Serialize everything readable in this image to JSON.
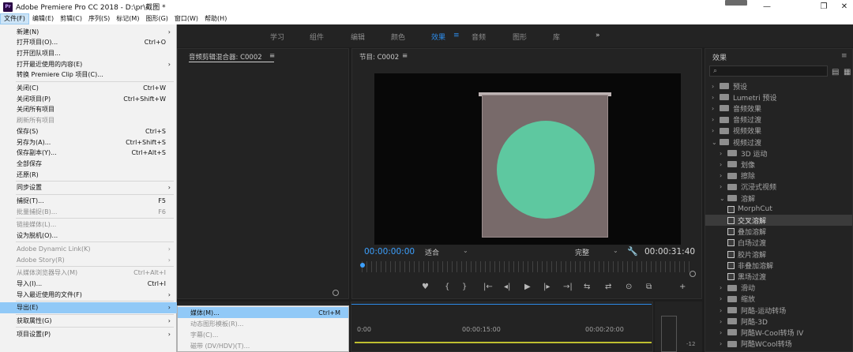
{
  "titlebar": {
    "app_icon": "Pr",
    "title": "Adobe Premiere Pro CC 2018 - D:\\pr\\截图 *",
    "minimize_icon": "minimize-icon",
    "maximize_icon": "maximize-icon",
    "close_icon": "close-icon"
  },
  "menubar": [
    "文件(F)",
    "编辑(E)",
    "剪辑(C)",
    "序列(S)",
    "标记(M)",
    "图形(G)",
    "窗口(W)",
    "帮助(H)"
  ],
  "workspaces": [
    "学习",
    "组件",
    "编辑",
    "颜色",
    "效果",
    "音频",
    "图形",
    "库",
    "»"
  ],
  "active_workspace": "效果",
  "mixer": {
    "title": "音频剪辑混合器: C0002",
    "menu_icon": "≡"
  },
  "program": {
    "title": "节目: C0002",
    "menu_icon": "≡",
    "timecode_current": "00:00:00:00",
    "fit": "适合",
    "quality": "完整",
    "timecode_total": "00:00:31:40",
    "controls": [
      "♥",
      "{",
      "}",
      "|←",
      "◂|",
      "▶",
      "|▸",
      "→|",
      "⇆",
      "⇄",
      "⊙",
      "⧉",
      "+"
    ]
  },
  "effects": {
    "title": "效果",
    "menu_icon": "≡",
    "search_placeholder": "⌕",
    "items": [
      {
        "label": "预设",
        "level": 0,
        "type": "folder",
        "arrow": "›"
      },
      {
        "label": "Lumetri 预设",
        "level": 0,
        "type": "folder",
        "arrow": "›"
      },
      {
        "label": "音频效果",
        "level": 0,
        "type": "folder",
        "arrow": "›"
      },
      {
        "label": "音频过渡",
        "level": 0,
        "type": "folder",
        "arrow": "›"
      },
      {
        "label": "视频效果",
        "level": 0,
        "type": "folder",
        "arrow": "›"
      },
      {
        "label": "视频过渡",
        "level": 0,
        "type": "folder",
        "arrow": "⌄"
      },
      {
        "label": "3D 运动",
        "level": 1,
        "type": "folder",
        "arrow": "›"
      },
      {
        "label": "划像",
        "level": 1,
        "type": "folder",
        "arrow": "›"
      },
      {
        "label": "擦除",
        "level": 1,
        "type": "folder",
        "arrow": "›"
      },
      {
        "label": "沉浸式视频",
        "level": 1,
        "type": "folder",
        "arrow": "›"
      },
      {
        "label": "溶解",
        "level": 1,
        "type": "folder",
        "arrow": "⌄"
      },
      {
        "label": "MorphCut",
        "level": 2,
        "type": "effect"
      },
      {
        "label": "交叉溶解",
        "level": 2,
        "type": "effect",
        "selected": true
      },
      {
        "label": "叠加溶解",
        "level": 2,
        "type": "effect"
      },
      {
        "label": "白场过渡",
        "level": 2,
        "type": "effect"
      },
      {
        "label": "胶片溶解",
        "level": 2,
        "type": "effect"
      },
      {
        "label": "非叠加溶解",
        "level": 2,
        "type": "effect"
      },
      {
        "label": "黑场过渡",
        "level": 2,
        "type": "effect"
      },
      {
        "label": "滑动",
        "level": 1,
        "type": "folder",
        "arrow": "›"
      },
      {
        "label": "缩放",
        "level": 1,
        "type": "folder",
        "arrow": "›"
      },
      {
        "label": "阿酷-运动转场",
        "level": 1,
        "type": "folder",
        "arrow": "›"
      },
      {
        "label": "阿酷-3D",
        "level": 1,
        "type": "folder",
        "arrow": "›"
      },
      {
        "label": "阿酷W-Cool转场 IV",
        "level": 1,
        "type": "folder",
        "arrow": "›"
      },
      {
        "label": "阿酷WCool转场",
        "level": 1,
        "type": "folder",
        "arrow": "›"
      }
    ]
  },
  "timeline": {
    "ticks": [
      "0:00",
      "00:00:15:00",
      "00:00:20:00"
    ]
  },
  "meter": {
    "db_label": "-12"
  },
  "file_menu": [
    {
      "label": "新建(N)",
      "sub": "›"
    },
    {
      "label": "打开项目(O)...",
      "shortcut": "Ctrl+O"
    },
    {
      "label": "打开团队项目..."
    },
    {
      "label": "打开最近使用的内容(E)",
      "sub": "›"
    },
    {
      "label": "转换 Premiere Clip 项目(C)..."
    },
    {
      "sep": true
    },
    {
      "label": "关闭(C)",
      "shortcut": "Ctrl+W"
    },
    {
      "label": "关闭项目(P)",
      "shortcut": "Ctrl+Shift+W"
    },
    {
      "label": "关闭所有项目"
    },
    {
      "label": "刷新所有项目",
      "disabled": true
    },
    {
      "label": "保存(S)",
      "shortcut": "Ctrl+S"
    },
    {
      "label": "另存为(A)...",
      "shortcut": "Ctrl+Shift+S"
    },
    {
      "label": "保存副本(Y)...",
      "shortcut": "Ctrl+Alt+S"
    },
    {
      "label": "全部保存"
    },
    {
      "label": "还原(R)"
    },
    {
      "sep": true
    },
    {
      "label": "同步设置",
      "sub": "›"
    },
    {
      "sep": true
    },
    {
      "label": "捕捉(T)...",
      "shortcut": "F5"
    },
    {
      "label": "批量捕捉(B)...",
      "shortcut": "F6",
      "disabled": true
    },
    {
      "sep": true
    },
    {
      "label": "链接媒体(L)...",
      "disabled": true
    },
    {
      "label": "设为脱机(O)..."
    },
    {
      "sep": true
    },
    {
      "label": "Adobe Dynamic Link(K)",
      "sub": "›",
      "disabled": true
    },
    {
      "label": "Adobe Story(R)",
      "sub": "›",
      "disabled": true
    },
    {
      "sep": true
    },
    {
      "label": "从媒体浏览器导入(M)",
      "shortcut": "Ctrl+Alt+I",
      "disabled": true
    },
    {
      "label": "导入(I)...",
      "shortcut": "Ctrl+I"
    },
    {
      "label": "导入最近使用的文件(F)",
      "sub": "›"
    },
    {
      "sep": true
    },
    {
      "label": "导出(E)",
      "sub": "›",
      "highlighted": true
    },
    {
      "sep": true
    },
    {
      "label": "获取属性(G)",
      "sub": "›"
    },
    {
      "sep": true
    },
    {
      "label": "项目设置(P)",
      "sub": "›"
    }
  ],
  "export_submenu": [
    {
      "label": "媒体(M)...",
      "shortcut": "Ctrl+M",
      "highlighted": true
    },
    {
      "label": "动态图形模板(R)...",
      "disabled": true
    },
    {
      "label": "字幕(C)...",
      "disabled": true
    },
    {
      "label": "磁带 (DV/HDV)(T)...",
      "disabled": true
    }
  ]
}
